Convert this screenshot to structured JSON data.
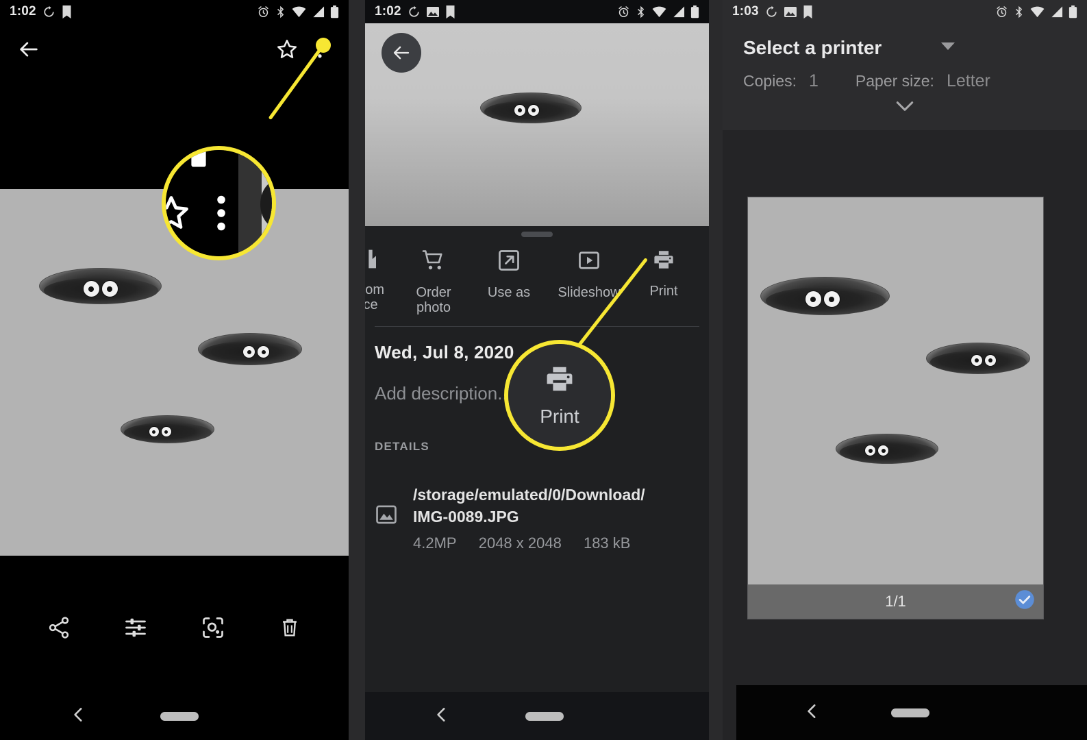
{
  "panels": [
    {
      "id": "photo-viewer",
      "statusbar": {
        "time": "1:02",
        "left_icons": [
          "sync-icon",
          "bookmark-icon"
        ],
        "right_icons": [
          "alarm-icon",
          "bluetooth-icon",
          "wifi-icon",
          "signal-icon",
          "battery-icon"
        ]
      },
      "appbar": {
        "back": "back-arrow-icon",
        "star": "star-outline-icon",
        "overflow": "more-vertical-icon"
      },
      "bottom_actions": [
        {
          "name": "share",
          "icon": "share-icon"
        },
        {
          "name": "edit",
          "icon": "tune-sliders-icon"
        },
        {
          "name": "lens",
          "icon": "google-lens-icon"
        },
        {
          "name": "delete",
          "icon": "trash-icon"
        }
      ],
      "navbar": {
        "back": "nav-back-icon",
        "home": "nav-home-pill"
      },
      "callout": {
        "target": "overflow-menu-button",
        "magnified_icon": "more-vertical-icon"
      }
    },
    {
      "id": "photo-details",
      "statusbar": {
        "time": "1:02",
        "left_icons": [
          "sync-icon",
          "image-icon",
          "bookmark-icon"
        ],
        "right_icons": [
          "alarm-icon",
          "bluetooth-icon",
          "wifi-icon",
          "signal-icon",
          "battery-icon"
        ]
      },
      "back_button": "back-arrow-icon",
      "actions": [
        {
          "label_line1": "from",
          "label_line2": "ce",
          "icon": "add-from-device-icon",
          "clipped": true
        },
        {
          "label_line1": "Order",
          "label_line2": "photo",
          "icon": "shopping-cart-icon"
        },
        {
          "label_line1": "Use as",
          "label_line2": "",
          "icon": "open-external-icon"
        },
        {
          "label_line1": "Slideshow",
          "label_line2": "",
          "icon": "slideshow-icon"
        },
        {
          "label_line1": "Print",
          "label_line2": "",
          "icon": "printer-icon"
        }
      ],
      "date": "Wed, Jul 8, 2020",
      "description_placeholder": "Add description...",
      "details_header": "DETAILS",
      "file": {
        "icon": "image-file-icon",
        "path": "/storage/emulated/0/Download/",
        "name": "IMG-0089.JPG",
        "megapixels": "4.2MP",
        "dimensions": "2048 x 2048",
        "size": "183 kB"
      },
      "navbar": {
        "back": "nav-back-icon",
        "home": "nav-home-pill"
      },
      "callout": {
        "target": "print-action",
        "magnified_label": "Print",
        "magnified_icon": "printer-icon"
      }
    },
    {
      "id": "print-dialog",
      "statusbar": {
        "time": "1:03",
        "left_icons": [
          "sync-icon",
          "image-icon",
          "bookmark-icon"
        ],
        "right_icons": [
          "alarm-icon",
          "bluetooth-icon",
          "wifi-icon",
          "signal-icon",
          "battery-icon"
        ]
      },
      "printer_select": "Select a printer",
      "printer_caret": "chevron-down-icon",
      "copies_label": "Copies:",
      "copies_value": "1",
      "paper_label": "Paper size:",
      "paper_value": "Letter",
      "expand_icon": "chevron-down-icon",
      "page_indicator": "1/1",
      "page_check": "check-circle-icon",
      "navbar": {
        "back": "nav-back-icon",
        "home": "nav-home-pill"
      }
    }
  ],
  "colors": {
    "accent_highlight": "#f7e733",
    "photo_background": "#b3b3b3",
    "sheet_background": "#1f2022",
    "check_blue": "#5b8dd6"
  }
}
